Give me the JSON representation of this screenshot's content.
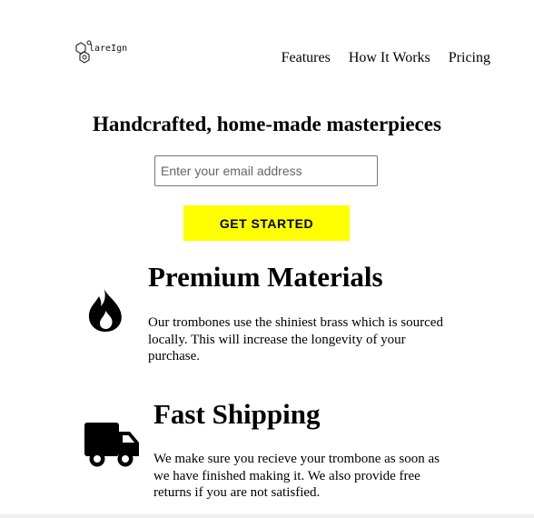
{
  "header": {
    "logo_text": "lareIgn",
    "nav": [
      {
        "label": "Features"
      },
      {
        "label": "How It Works"
      },
      {
        "label": "Pricing"
      }
    ]
  },
  "hero": {
    "title": "Handcrafted, home-made masterpieces",
    "email_placeholder": "Enter your email address",
    "cta_label": "GET STARTED"
  },
  "features": [
    {
      "icon": "fire-icon",
      "title": "Premium Materials",
      "text": "Our trombones use the shiniest brass which is sourced locally. This will increase the longevity of your purchase."
    },
    {
      "icon": "truck-icon",
      "title": "Fast Shipping",
      "text": "We make sure you recieve your trombone as soon as we have finished making it. We also provide free returns if you are not satisfied."
    }
  ]
}
